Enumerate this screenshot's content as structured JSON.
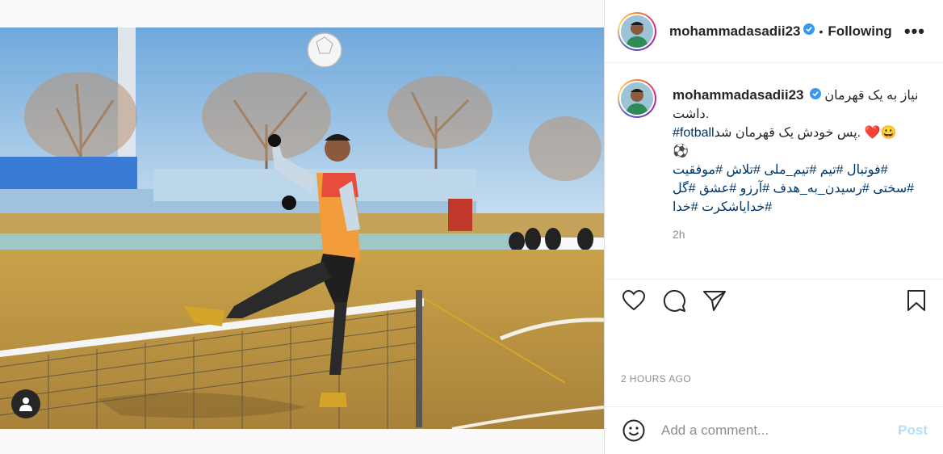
{
  "post": {
    "username": "mohammadasadii23",
    "follow_separator": "•",
    "follow_status": "Following",
    "more_label": "•••",
    "caption": {
      "username": "mohammadasadii23",
      "line1": "نیاز به یک قهرمان",
      "line2": "داشت.",
      "line3_text": "پس خودش یک قهرمان شد.",
      "line3_tag": "#fotball",
      "line3_emoji": "❤️😀",
      "line4_emoji": "⚽",
      "hashtags_line1": "فوتبال #تیم #تیم_ملی #تلاش #موفقیت#",
      "hashtags_line2": "سختی #رسیدن_به_هدف #آرزو #عشق #گل#",
      "hashtags_line3": "خداياشکرت #خدا#",
      "relative_time": "2h"
    },
    "posted_time": "2 HOURS AGO",
    "comment": {
      "placeholder": "Add a comment...",
      "post_label": "Post"
    },
    "icons": {
      "like": "heart-icon",
      "comment": "comment-icon",
      "share": "share-icon",
      "save": "bookmark-icon",
      "emoji": "emoji-icon",
      "tag": "user-tag-icon",
      "verified": "verified-badge-icon"
    },
    "colors": {
      "verified": "#3897f0",
      "post_disabled": "#b2dffc",
      "hashtag": "#00376b",
      "muted": "#8e8e8e"
    }
  }
}
